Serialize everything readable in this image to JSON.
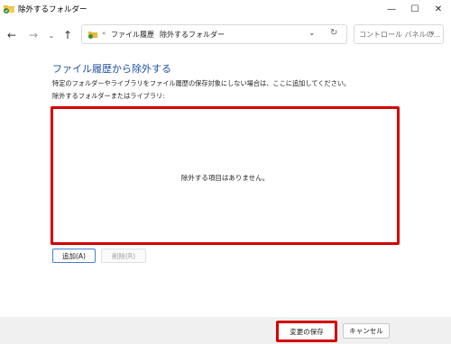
{
  "window": {
    "title": "除外するフォルダー",
    "icon": "file-history-folder-icon",
    "minimize_glyph": "—",
    "maximize_glyph": "☐",
    "close_glyph": "✕"
  },
  "navigation": {
    "back_icon": "arrow-left-icon",
    "back_glyph": "←",
    "forward_icon": "arrow-right-icon",
    "forward_glyph": "→",
    "recent_icon": "chevron-down-icon",
    "recent_glyph": "⌄",
    "up_icon": "arrow-up-icon",
    "up_glyph": "↑"
  },
  "address_bar": {
    "overflow_glyph": "«",
    "breadcrumbs": [
      "ファイル履歴",
      "除外するフォルダー"
    ],
    "separator_glyph": "›",
    "dropdown_glyph": "⌄",
    "refresh_glyph": "↻"
  },
  "search": {
    "placeholder": "コントロール パネルの...",
    "icon_glyph": "⌕"
  },
  "main": {
    "heading": "ファイル履歴から除外する",
    "description": "特定のフォルダーやライブラリをファイル履歴の保存対象にしない場合は、ここに追加してください。",
    "list_label": "除外するフォルダーまたはライブラリ:",
    "empty_message": "除外する項目はありません。",
    "add_button": "追加(A)",
    "remove_button": "削除(R)"
  },
  "footer": {
    "save_button": "変更の保存",
    "cancel_button": "キャンセル"
  },
  "colors": {
    "heading": "#1e50a2",
    "highlight_border": "#d40000",
    "footer_bg": "#f0f0f0"
  }
}
